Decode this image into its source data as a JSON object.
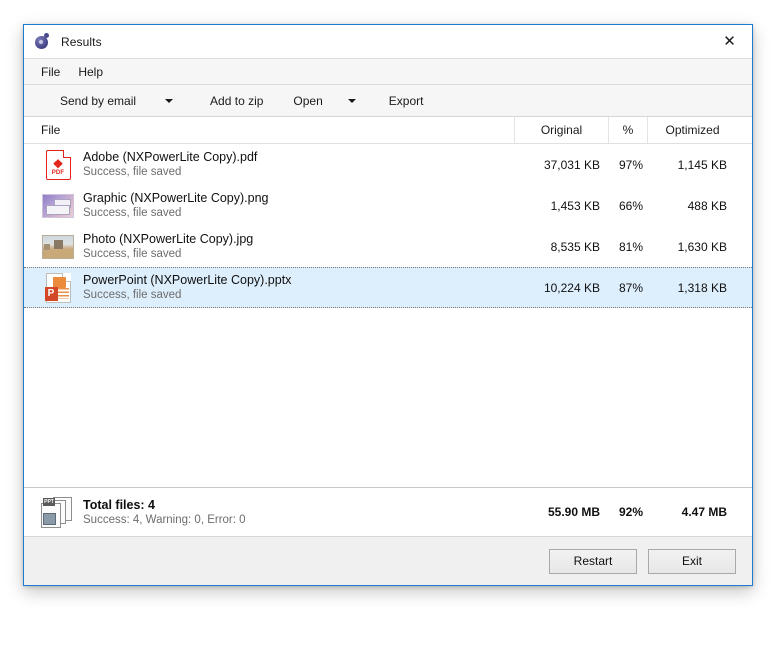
{
  "window": {
    "title": "Results",
    "app_icon": "nxpowerlite-logo-icon",
    "close_label": "✕",
    "accent_color": "#1e7bd0"
  },
  "menubar": {
    "items": [
      {
        "label": "File"
      },
      {
        "label": "Help"
      }
    ]
  },
  "toolbar": {
    "send_by_email": "Send by email",
    "add_to_zip": "Add to zip",
    "open": "Open",
    "export": "Export"
  },
  "list": {
    "columns": {
      "file": "File",
      "original": "Original",
      "percent": "%",
      "optimized": "Optimized"
    },
    "rows": [
      {
        "icon": "pdf-file-icon",
        "name": "Adobe (NXPowerLite Copy).pdf",
        "status": "Success, file saved",
        "original": "37,031 KB",
        "percent": "97%",
        "optimized": "1,145 KB",
        "selected": false
      },
      {
        "icon": "png-image-icon",
        "name": "Graphic (NXPowerLite Copy).png",
        "status": "Success, file saved",
        "original": "1,453 KB",
        "percent": "66%",
        "optimized": "488 KB",
        "selected": false
      },
      {
        "icon": "jpg-photo-icon",
        "name": "Photo (NXPowerLite Copy).jpg",
        "status": "Success, file saved",
        "original": "8,535 KB",
        "percent": "81%",
        "optimized": "1,630 KB",
        "selected": false
      },
      {
        "icon": "powerpoint-file-icon",
        "name": "PowerPoint (NXPowerLite Copy).pptx",
        "status": "Success, file saved",
        "original": "10,224 KB",
        "percent": "87%",
        "optimized": "1,318 KB",
        "selected": true
      }
    ]
  },
  "summary": {
    "icon": "stacked-documents-icon",
    "title": "Total files: 4",
    "subtitle": "Success: 4, Warning: 0, Error: 0",
    "original": "55.90 MB",
    "percent": "92%",
    "optimized": "4.47 MB"
  },
  "footer": {
    "restart": "Restart",
    "exit": "Exit"
  }
}
